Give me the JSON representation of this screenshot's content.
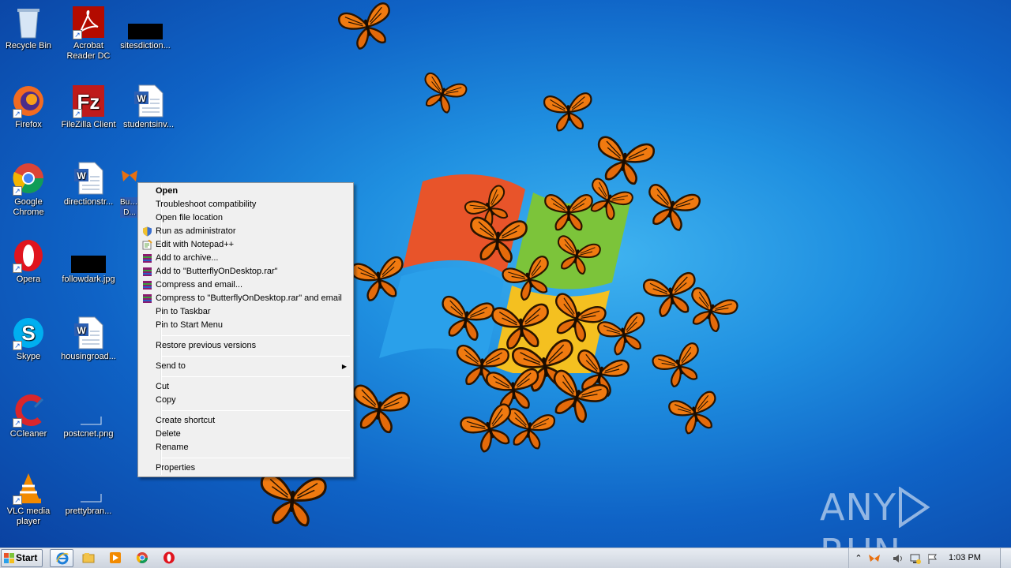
{
  "desktop": {
    "icons": [
      {
        "label": "Recycle Bin"
      },
      {
        "label": "Acrobat Reader DC"
      },
      {
        "label": "sitesdiction..."
      },
      {
        "label": "Firefox"
      },
      {
        "label": "FileZilla Client"
      },
      {
        "label": "studentsinv..."
      },
      {
        "label": "Google Chrome"
      },
      {
        "label": "directionstr..."
      },
      {
        "label": "Butt... D..."
      },
      {
        "label": "Opera"
      },
      {
        "label": "followdark.jpg"
      },
      {
        "label": "Skype"
      },
      {
        "label": "housingroad..."
      },
      {
        "label": "CCleaner"
      },
      {
        "label": "postcnet.png"
      },
      {
        "label": "VLC media player"
      },
      {
        "label": "prettybran..."
      }
    ]
  },
  "context_menu": {
    "items": [
      {
        "label": "Open"
      },
      {
        "label": "Troubleshoot compatibility"
      },
      {
        "label": "Open file location"
      },
      {
        "label": "Run as administrator",
        "icon": "shield-icon"
      },
      {
        "label": "Edit with Notepad++",
        "icon": "notepad-plus-icon"
      },
      {
        "label": "Add to archive...",
        "icon": "winrar-icon"
      },
      {
        "label": "Add to \"ButterflyOnDesktop.rar\"",
        "icon": "winrar-icon"
      },
      {
        "label": "Compress and email...",
        "icon": "winrar-icon"
      },
      {
        "label": "Compress to \"ButterflyOnDesktop.rar\" and email",
        "icon": "winrar-icon"
      },
      {
        "label": "Pin to Taskbar"
      },
      {
        "label": "Pin to Start Menu"
      },
      {
        "label": "Restore previous versions"
      },
      {
        "label": "Send to"
      },
      {
        "label": "Cut"
      },
      {
        "label": "Copy"
      },
      {
        "label": "Create shortcut"
      },
      {
        "label": "Delete"
      },
      {
        "label": "Rename"
      },
      {
        "label": "Properties"
      }
    ]
  },
  "watermark": {
    "left": "ANY",
    "right": "RUN"
  },
  "taskbar": {
    "start_label": "Start",
    "pinned": [
      "internet-explorer-icon",
      "explorer-icon",
      "media-player-icon",
      "chrome-icon",
      "opera-icon"
    ],
    "clock": "1:03 PM"
  },
  "colors": {
    "desktop_blue": "#1f8fe0",
    "butterfly_orange": "#f07a10",
    "menu_bg": "#f0f0f0",
    "taskbar_bg": "#dde3eb"
  }
}
